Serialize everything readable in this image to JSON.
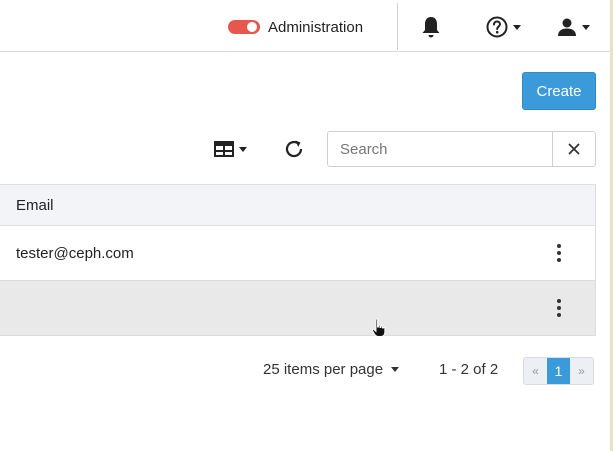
{
  "navbar": {
    "admin_label": "Administration",
    "admin_toggle_on": true,
    "icons": [
      "bell-icon",
      "help-icon",
      "user-icon"
    ]
  },
  "actions": {
    "create_label": "Create"
  },
  "toolbar": {
    "search_placeholder": "Search",
    "search_value": "",
    "icons": [
      "table-columns-icon",
      "refresh-icon",
      "close-icon"
    ]
  },
  "table": {
    "columns": [
      "Email"
    ],
    "rows": [
      {
        "email": "tester@ceph.com"
      },
      {
        "email": ""
      }
    ]
  },
  "footer": {
    "per_page_label": "25 items per page",
    "range_label": "1 - 2 of 2",
    "prev_label": "«",
    "current_page": "1",
    "next_label": "»"
  },
  "colors": {
    "accent": "#3b9ad9",
    "toggle_on": "#e8574e",
    "header_bg": "#f3f4f8",
    "selected_row_bg": "#e9e9ea"
  }
}
